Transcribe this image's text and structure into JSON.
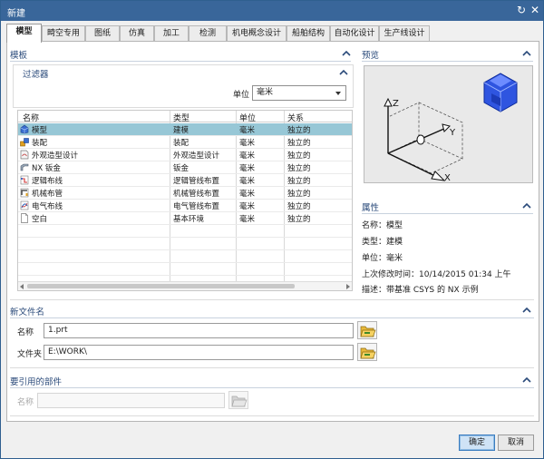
{
  "window": {
    "title": "新建"
  },
  "tabs": [
    {
      "label": "模型",
      "active": true
    },
    {
      "label": "畸空专用"
    },
    {
      "label": "图纸"
    },
    {
      "label": "仿真"
    },
    {
      "label": "加工"
    },
    {
      "label": "检测"
    },
    {
      "label": "机电概念设计"
    },
    {
      "label": "船舶结构"
    },
    {
      "label": "自动化设计"
    },
    {
      "label": "生产线设计"
    }
  ],
  "templates": {
    "title": "模板",
    "filter": {
      "title": "过滤器",
      "unit_label": "单位",
      "unit_value": "毫米"
    },
    "columns": [
      "名称",
      "类型",
      "单位",
      "关系"
    ],
    "rows": [
      {
        "name": "模型",
        "type": "建模",
        "unit": "毫米",
        "relation": "独立的",
        "icon": "model-icon",
        "selected": true
      },
      {
        "name": "装配",
        "type": "装配",
        "unit": "毫米",
        "relation": "独立的",
        "icon": "assembly-icon"
      },
      {
        "name": "外观造型设计",
        "type": "外观造型设计",
        "unit": "毫米",
        "relation": "独立的",
        "icon": "shape-studio-icon"
      },
      {
        "name": "NX 钣金",
        "type": "钣金",
        "unit": "毫米",
        "relation": "独立的",
        "icon": "sheet-metal-icon"
      },
      {
        "name": "逻辑布线",
        "type": "逻辑管线布置",
        "unit": "毫米",
        "relation": "独立的",
        "icon": "logical-routing-icon"
      },
      {
        "name": "机械布管",
        "type": "机械管线布置",
        "unit": "毫米",
        "relation": "独立的",
        "icon": "mechanical-routing-icon"
      },
      {
        "name": "电气布线",
        "type": "电气管线布置",
        "unit": "毫米",
        "relation": "独立的",
        "icon": "electrical-routing-icon"
      },
      {
        "name": "空白",
        "type": "基本环境",
        "unit": "毫米",
        "relation": "独立的",
        "icon": "blank-icon"
      }
    ]
  },
  "preview": {
    "title": "预览",
    "axes": [
      "Z",
      "Y",
      "X"
    ]
  },
  "properties": {
    "title": "属性",
    "items": [
      {
        "label": "名称：",
        "value": "模型"
      },
      {
        "label": "类型：",
        "value": "建模"
      },
      {
        "label": "单位：",
        "value": "毫米"
      },
      {
        "label": "上次修改时间：",
        "value": "10/14/2015 01:34 上午"
      },
      {
        "label": "描述：",
        "value": "带基准 CSYS 的 NX 示例"
      }
    ]
  },
  "new_file": {
    "title": "新文件名",
    "name_label": "名称",
    "name_value": "1.prt",
    "folder_label": "文件夹",
    "folder_value": "E:\\WORK\\"
  },
  "referenced_part": {
    "title": "要引用的部件",
    "name_label": "名称",
    "name_value": ""
  },
  "buttons": {
    "ok": "确定",
    "cancel": "取消"
  }
}
